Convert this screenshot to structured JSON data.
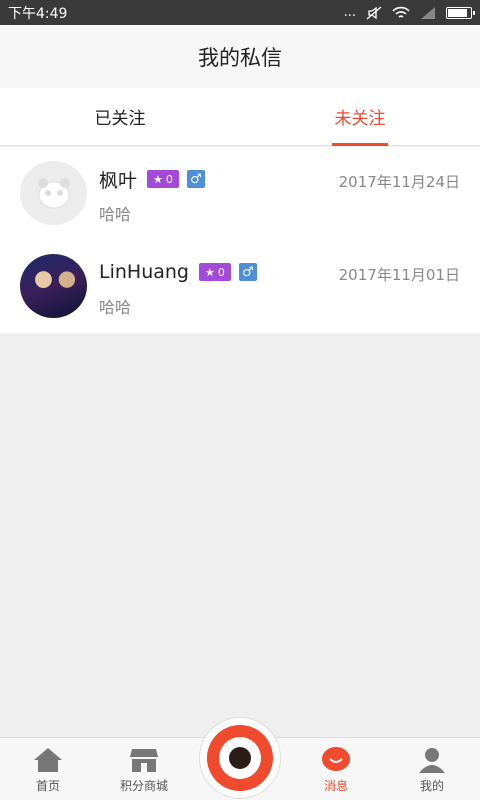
{
  "status_bar": {
    "time": "下午4:49",
    "dots": "...",
    "wifi_icon": "wifi-icon",
    "signal_icon": "signal-icon"
  },
  "header": {
    "title": "我的私信"
  },
  "tabs": [
    {
      "label": "已关注",
      "active": false
    },
    {
      "label": "未关注",
      "active": true
    }
  ],
  "messages": [
    {
      "name": "枫叶",
      "badge_count": "0",
      "badge_icon": "star-icon",
      "gender_icon": "male-icon",
      "gender_symbol": "♂",
      "date": "2017年11月24日",
      "preview": "哈哈",
      "avatar": "default-avatar-icon"
    },
    {
      "name": "LinHuang",
      "badge_count": "0",
      "badge_icon": "star-icon",
      "gender_icon": "male-icon",
      "gender_symbol": "♂",
      "date": "2017年11月01日",
      "preview": "哈哈",
      "avatar": "photo-avatar"
    }
  ],
  "bottom_nav": {
    "home": "首页",
    "shop": "积分商城",
    "messages": "消息",
    "mine": "我的"
  },
  "colors": {
    "accent": "#f04a2f",
    "badge": "#a34ad8",
    "gender": "#4d8fd9"
  }
}
